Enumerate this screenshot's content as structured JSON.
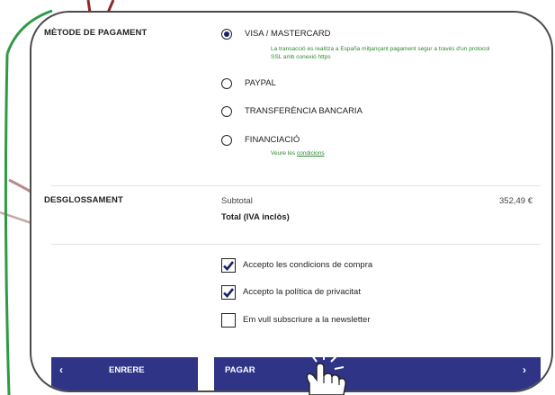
{
  "payment": {
    "section_title": "MÈTODE DE PAGAMENT",
    "options": [
      {
        "label": "VISA / MASTERCARD",
        "selected": true
      },
      {
        "label": "PAYPAL",
        "selected": false
      },
      {
        "label": "TRANSFERÈNCIA BANCARIA",
        "selected": false
      },
      {
        "label": "FINANCIACIÓ",
        "selected": false
      }
    ],
    "visa_note_line1": "La transacció es realitza a España mitjançant pagament segur a través d'un protocol",
    "visa_note_line2": "SSL amb conexió https",
    "financing_note": "Veure les",
    "financing_link": "condicions"
  },
  "breakdown": {
    "section_title": "DESGLOSSAMENT",
    "subtotal_label": "Subtotal",
    "subtotal_value": "352,49 €",
    "total_label": "Total (IVA inclòs)"
  },
  "consents": [
    {
      "label": "Accepto les condicions de compra",
      "checked": true
    },
    {
      "label": "Accepto la política de privacitat",
      "checked": true
    },
    {
      "label": "Em vull subscriure a la newsletter",
      "checked": false
    }
  ],
  "buttons": {
    "back_label": "ENRERE",
    "back_icon": "‹",
    "pay_label": "PAGAR",
    "pay_icon": "›"
  },
  "colors": {
    "accent": "#2f3487",
    "note_green": "#2f8a2f",
    "frame_green": "#2e9a44"
  },
  "icons": [
    "chevron-left-icon",
    "chevron-right-icon",
    "checkmark-icon",
    "pointing-hand-cursor-icon"
  ]
}
